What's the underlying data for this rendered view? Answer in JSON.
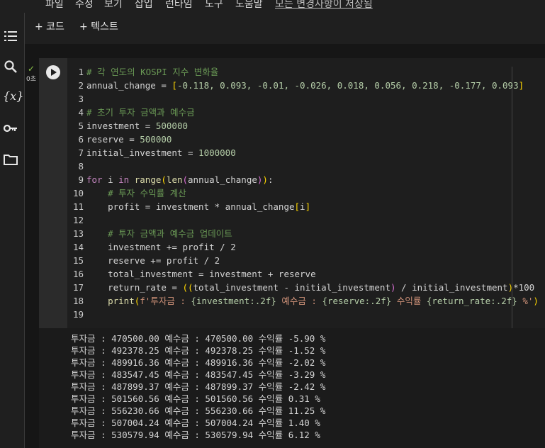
{
  "menu": {
    "items": [
      "파일",
      "수정",
      "보기",
      "삽입",
      "런타임",
      "도구",
      "도움말"
    ],
    "saved_status": "모든 변경사항이 저장됨"
  },
  "sidebar": {
    "icons": [
      "table-of-contents-icon",
      "search-icon",
      "variables-icon",
      "key-icon",
      "folder-icon"
    ],
    "variables_glyph": "{x}"
  },
  "toolbar": {
    "add_code": "+ 코드",
    "add_text": "+ 텍스트"
  },
  "cell": {
    "exec_check": "✓",
    "exec_time": "0초",
    "line_numbers": [
      "1",
      "2",
      "3",
      "4",
      "5",
      "6",
      "7",
      "8",
      "9",
      "10",
      "11",
      "12",
      "13",
      "14",
      "15",
      "16",
      "17",
      "18",
      "19"
    ],
    "code": {
      "l1": "# 각 연도의 KOSPI 지수 변화율",
      "l2_a": "annual_change = ",
      "l2_b": "[",
      "l2_c": "-0.118, 0.093, -0.01, -0.026, 0.018, 0.056, 0.218, -0.177, 0.093",
      "l2_d": "]",
      "l4": "# 초기 투자 금액과 예수금",
      "l5_a": "investment = ",
      "l5_b": "500000",
      "l6_a": "reserve = ",
      "l6_b": "500000",
      "l7_a": "initial_investment = ",
      "l7_b": "1000000",
      "l9_a": "for",
      "l9_b": " i ",
      "l9_c": "in",
      "l9_d": " ",
      "l9_e": "range",
      "l9_f": "(",
      "l9_g": "len",
      "l9_h": "(",
      "l9_i": "annual_change",
      "l9_j": ")",
      "l9_k": ")",
      "l9_l": ":",
      "l10": "    # 투자 수익률 계산",
      "l11_a": "    profit = investment * annual_change",
      "l11_b": "[",
      "l11_c": "i",
      "l11_d": "]",
      "l13": "    # 투자 금액과 예수금 업데이트",
      "l14": "    investment += profit / 2",
      "l15": "    reserve += profit / 2",
      "l16": "    total_investment = investment + reserve",
      "l17_a": "    return_rate = ",
      "l17_b": "((",
      "l17_c": "total_investment - initial_investment",
      "l17_d": ")",
      "l17_e": " / initial_investment",
      "l17_f": ")",
      "l17_g": "*100",
      "l18_a": "    ",
      "l18_b": "print",
      "l18_c": "(",
      "l18_d": "f'투자금 : ",
      "l18_e": "{investment:.2f}",
      "l18_f": " 예수금 : ",
      "l18_g": "{reserve:.2f}",
      "l18_h": " 수익률 ",
      "l18_i": "{return_rate:.2f}",
      "l18_j": " %'",
      "l18_k": ")"
    }
  },
  "output": {
    "lines": [
      "투자금 : 470500.00 예수금 : 470500.00 수익률 -5.90 %",
      "투자금 : 492378.25 예수금 : 492378.25 수익률 -1.52 %",
      "투자금 : 489916.36 예수금 : 489916.36 수익률 -2.02 %",
      "투자금 : 483547.45 예수금 : 483547.45 수익률 -3.29 %",
      "투자금 : 487899.37 예수금 : 487899.37 수익률 -2.42 %",
      "투자금 : 501560.56 예수금 : 501560.56 수익률 0.31 %",
      "투자금 : 556230.66 예수금 : 556230.66 수익률 11.25 %",
      "투자금 : 507004.24 예수금 : 507004.24 수익률 1.40 %",
      "투자금 : 530579.94 예수금 : 530579.94 수익률 6.12 %"
    ]
  }
}
